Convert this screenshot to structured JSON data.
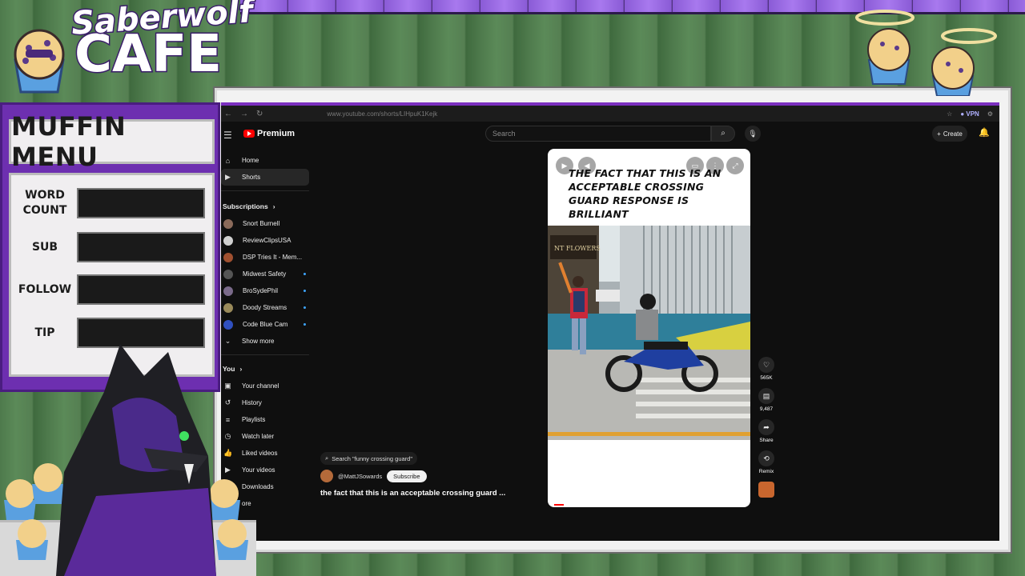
{
  "overlay": {
    "brand_line1": "Saberwolf",
    "brand_line2": "CAFE",
    "menu_title": "MUFFIN MENU",
    "stats": [
      {
        "label": "WORD COUNT",
        "value": ""
      },
      {
        "label": "SUB",
        "value": ""
      },
      {
        "label": "FOLLOW",
        "value": ""
      },
      {
        "label": "TIP",
        "value": ""
      }
    ]
  },
  "browser": {
    "url": "www.youtube.com/shorts/LIHpuK1Kejk",
    "vpn_label": "VPN"
  },
  "youtube": {
    "logo_text": "Premium",
    "search_placeholder": "Search",
    "create_label": "Create",
    "nav": [
      {
        "label": "Home",
        "icon": "home-icon"
      },
      {
        "label": "Shorts",
        "icon": "shorts-icon"
      }
    ],
    "subscriptions_label": "Subscriptions",
    "subscriptions": [
      {
        "label": "Snort Burnell",
        "avatar_color": "#8a6a5a",
        "new": false
      },
      {
        "label": "ReviewClipsUSA",
        "avatar_color": "#d0d0d0",
        "new": false
      },
      {
        "label": "DSP Tries It - Mem...",
        "avatar_color": "#a05030",
        "new": false
      },
      {
        "label": "Midwest Safety",
        "avatar_color": "#555555",
        "new": true
      },
      {
        "label": "BroSydePhil",
        "avatar_color": "#7a6a8a",
        "new": true
      },
      {
        "label": "Doody Streams",
        "avatar_color": "#9a8a5a",
        "new": true
      },
      {
        "label": "Code Blue Cam",
        "avatar_color": "#3050c0",
        "new": true
      }
    ],
    "show_more_label": "Show more",
    "you_label": "You",
    "you_items": [
      {
        "label": "Your channel",
        "icon": "user-icon"
      },
      {
        "label": "History",
        "icon": "history-icon"
      },
      {
        "label": "Playlists",
        "icon": "playlists-icon"
      },
      {
        "label": "Watch later",
        "icon": "clock-icon"
      },
      {
        "label": "Liked videos",
        "icon": "thumb-up-icon"
      },
      {
        "label": "Your videos",
        "icon": "video-icon"
      },
      {
        "label": "Downloads",
        "icon": "download-icon"
      }
    ],
    "more_label": "ore",
    "video": {
      "search_chip": "Search \"funny crossing guard\"",
      "channel": "@MattJSowards",
      "subscribe_label": "Subscribe",
      "title": "the fact that this is an acceptable crossing guard ...",
      "caption": "THE FACT THAT THIS IS AN ACCEPTABLE CROSSING GUARD RESPONSE IS BRILLIANT",
      "sign_text": "NT FLOWERS"
    },
    "actions": {
      "likes": "565K",
      "comments": "9,487",
      "share_label": "Share",
      "remix_label": "Remix"
    }
  }
}
